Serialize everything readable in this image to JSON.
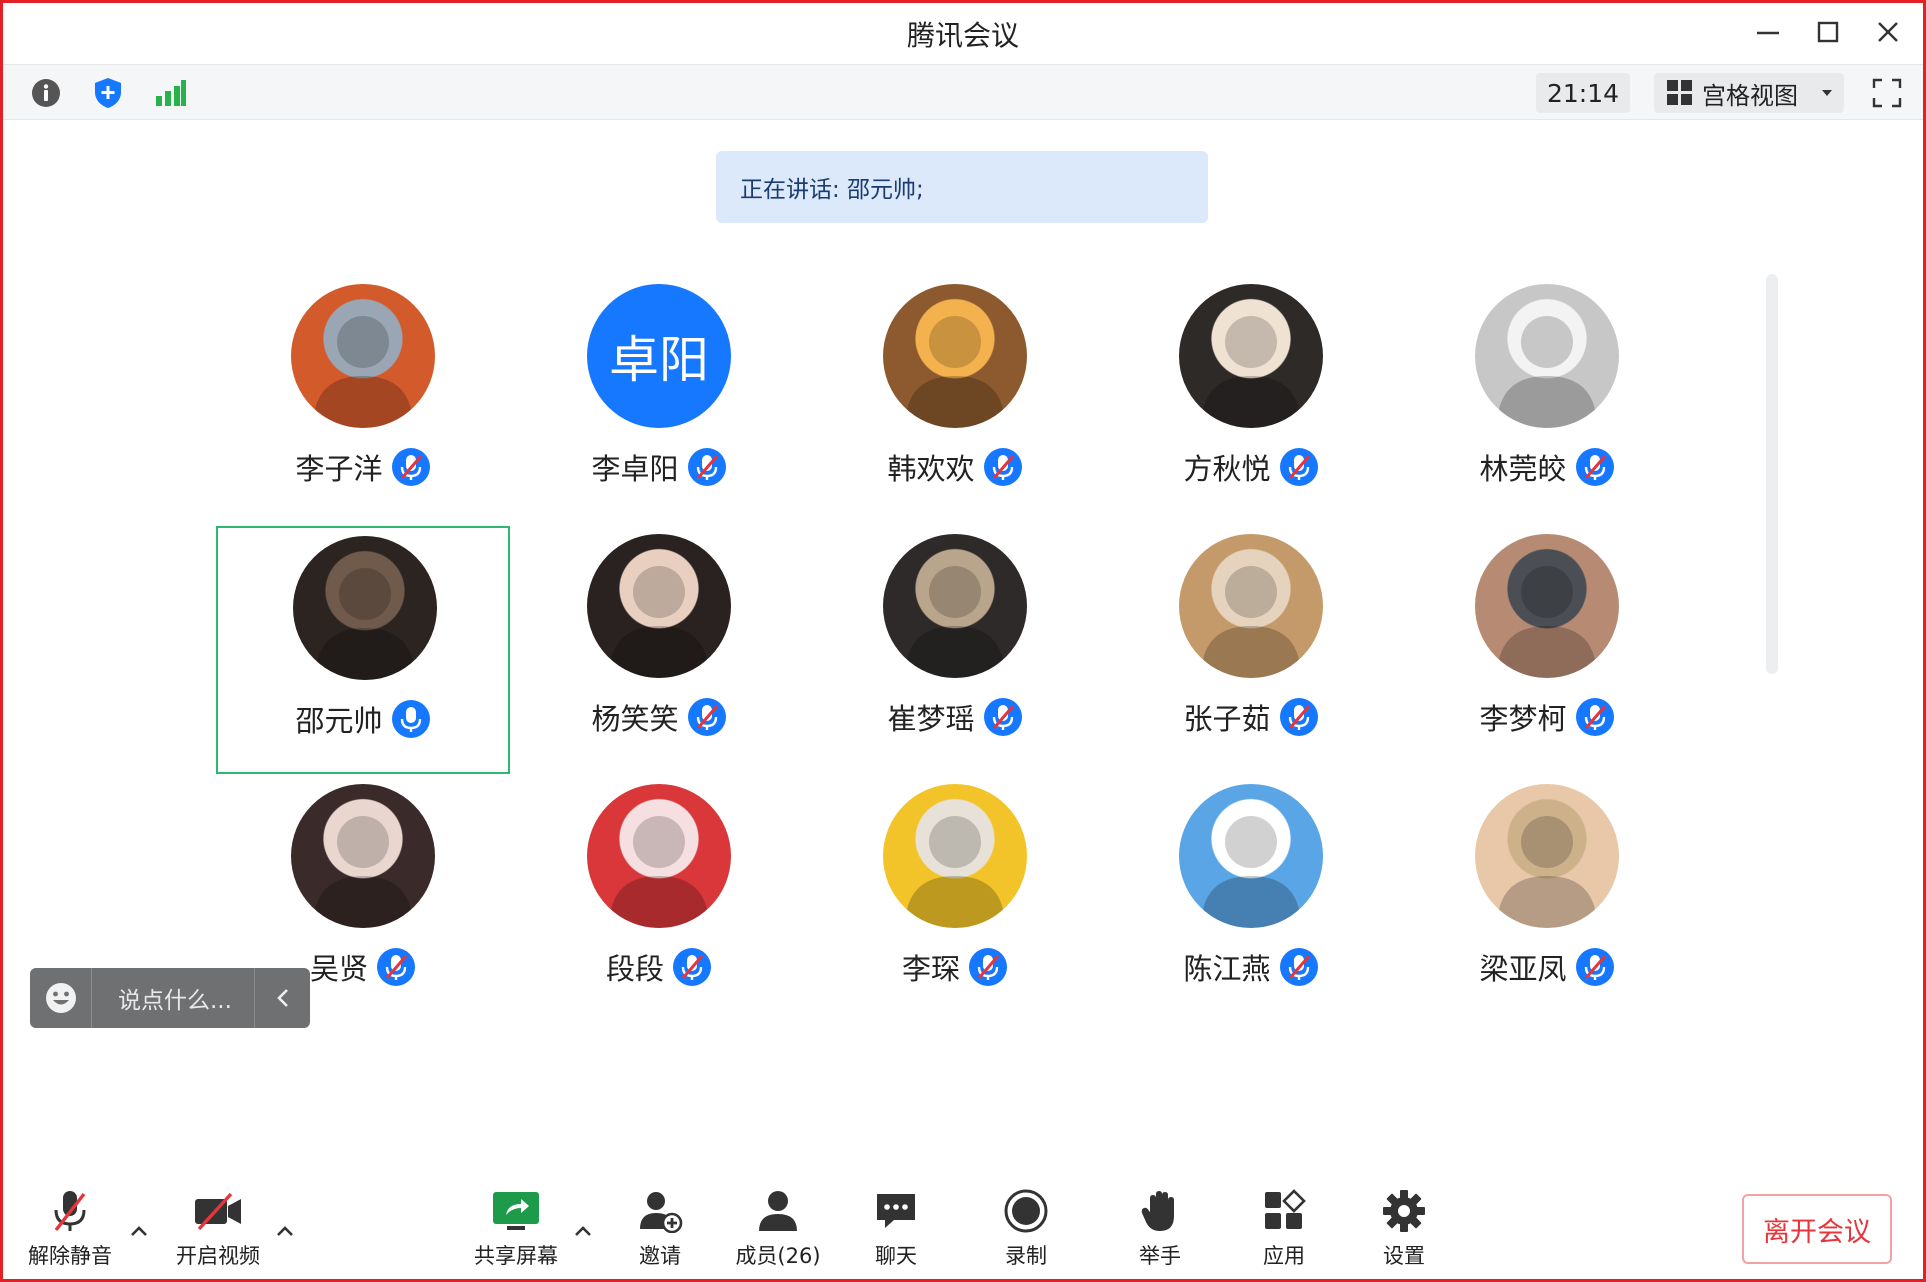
{
  "window": {
    "title": "腾讯会议"
  },
  "topbar": {
    "timer": "21:14",
    "view_mode": "宫格视图"
  },
  "speaking": {
    "text": "正在讲话: 邵元帅;"
  },
  "participants": [
    {
      "name": "李子洋",
      "mic": "muted",
      "avatar_text": ""
    },
    {
      "name": "李卓阳",
      "mic": "muted",
      "avatar_text": "卓阳"
    },
    {
      "name": "韩欢欢",
      "mic": "muted",
      "avatar_text": ""
    },
    {
      "name": "方秋悦",
      "mic": "muted",
      "avatar_text": ""
    },
    {
      "name": "林莞皎",
      "mic": "muted",
      "avatar_text": ""
    },
    {
      "name": "邵元帅",
      "mic": "on",
      "avatar_text": ""
    },
    {
      "name": "杨笑笑",
      "mic": "muted",
      "avatar_text": ""
    },
    {
      "name": "崔梦瑶",
      "mic": "muted",
      "avatar_text": ""
    },
    {
      "name": "张子茹",
      "mic": "muted",
      "avatar_text": ""
    },
    {
      "name": "李梦柯",
      "mic": "muted",
      "avatar_text": ""
    },
    {
      "name": "吴贤",
      "mic": "muted",
      "avatar_text": ""
    },
    {
      "name": "段段",
      "mic": "muted",
      "avatar_text": ""
    },
    {
      "name": "李琛",
      "mic": "muted",
      "avatar_text": ""
    },
    {
      "name": "陈江燕",
      "mic": "muted",
      "avatar_text": ""
    },
    {
      "name": "梁亚凤",
      "mic": "muted",
      "avatar_text": ""
    }
  ],
  "chat": {
    "placeholder": "说点什么..."
  },
  "toolbar": {
    "unmute": "解除静音",
    "start_video": "开启视频",
    "share_screen": "共享屏幕",
    "invite": "邀请",
    "members": "成员(26)",
    "chat": "聊天",
    "record": "录制",
    "raise_hand": "举手",
    "apps": "应用",
    "settings": "设置",
    "leave": "离开会议"
  },
  "colors": {
    "accent": "#1677ff",
    "active_border": "#2eb872",
    "leave": "#e7353b",
    "frame": "#e32026"
  }
}
